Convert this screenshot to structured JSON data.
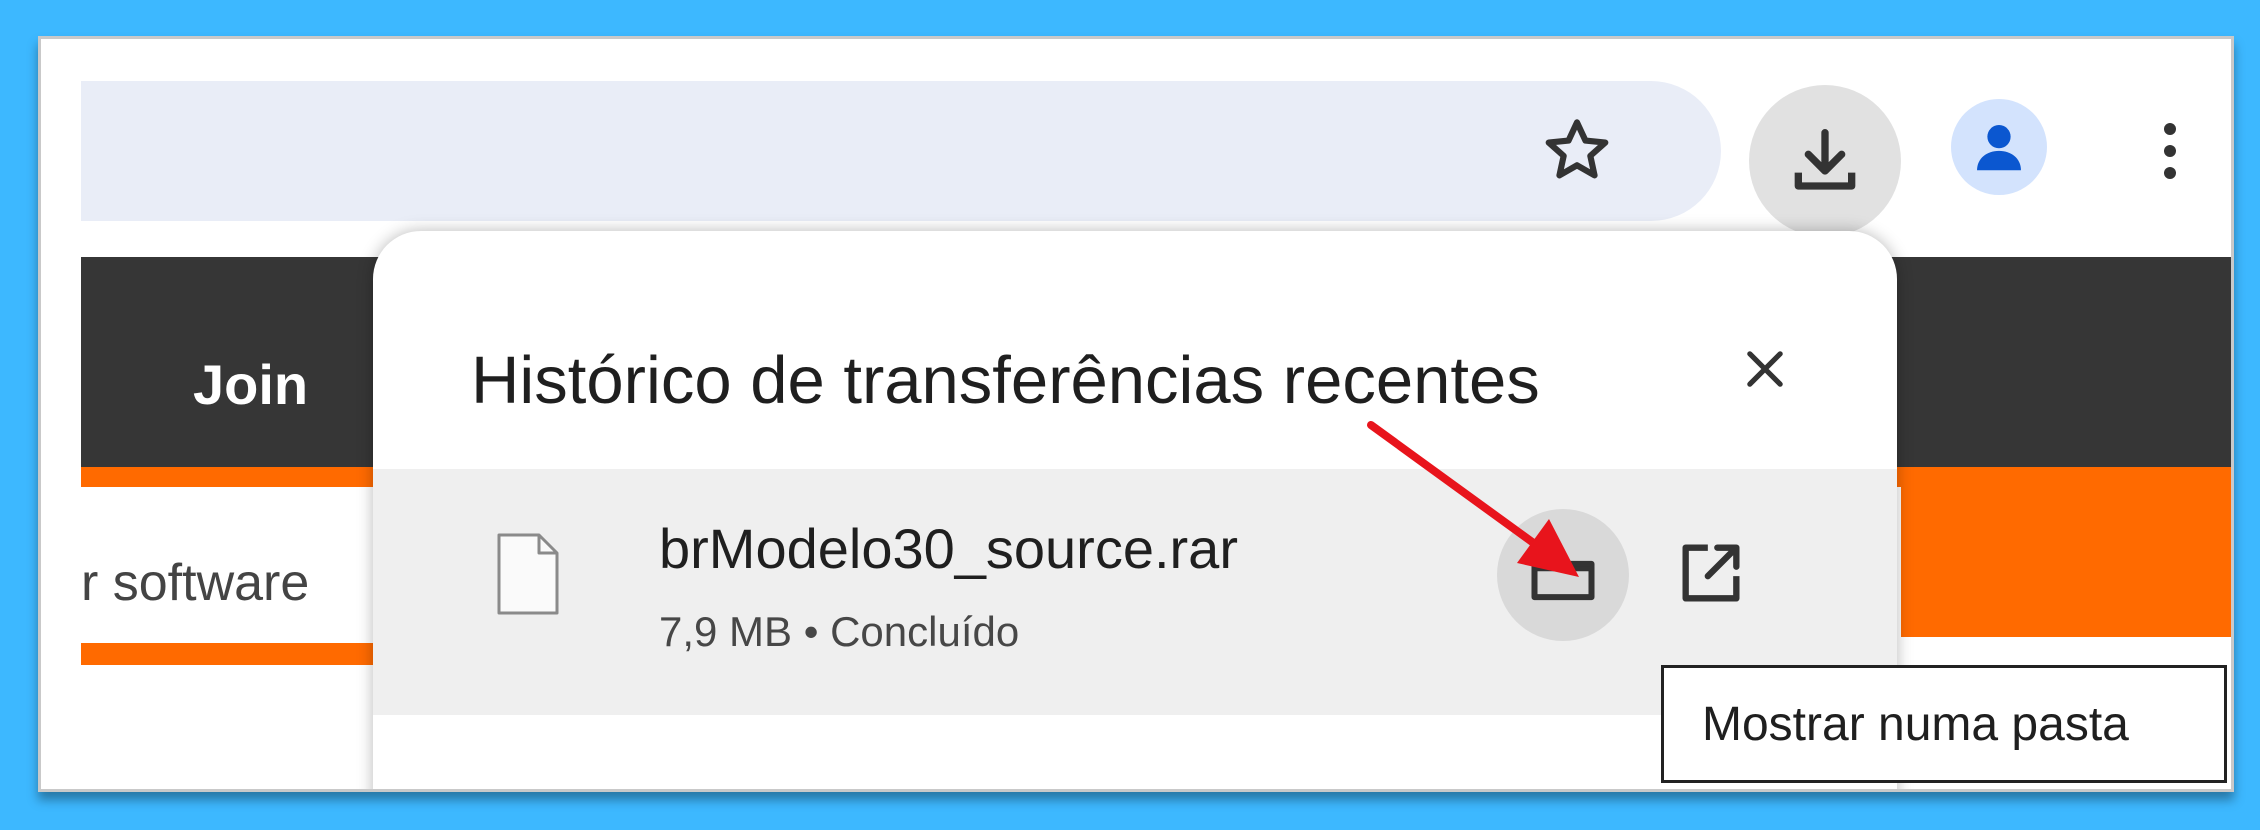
{
  "toolbar": {
    "star_icon": "star-outline-icon",
    "download_icon": "download-icon",
    "profile_icon": "account-circle-icon",
    "menu_icon": "more-vert-icon"
  },
  "page": {
    "nav_join": "Join",
    "snippet": "r software"
  },
  "downloads_popup": {
    "title": "Histórico de transferências recentes",
    "close_icon": "close-icon",
    "items": [
      {
        "filename": "brModelo30_source.rar",
        "meta": "7,9 MB • Concluído",
        "file_icon": "file-icon",
        "folder_icon": "folder-icon",
        "open_icon": "open-external-icon"
      }
    ]
  },
  "tooltip": {
    "text": "Mostrar numa pasta"
  },
  "colors": {
    "background": "#3db8ff",
    "orange": "#ff6a00",
    "annotation_arrow": "#e8141c",
    "avatar": "#0b57d0"
  }
}
